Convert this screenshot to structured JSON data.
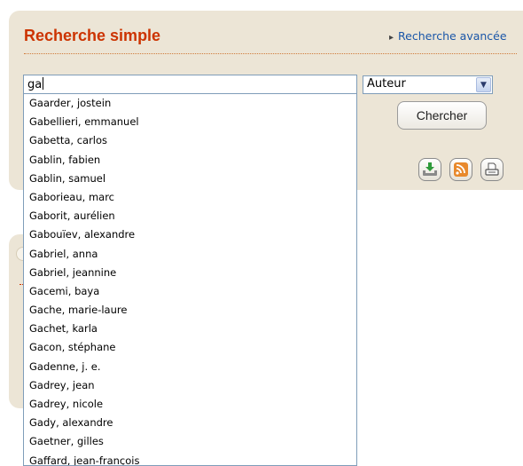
{
  "header": {
    "title": "Recherche simple",
    "advanced_link": "Recherche avancée"
  },
  "search": {
    "value": "ga",
    "field_select": "Auteur",
    "submit_label": "Chercher"
  },
  "actions": [
    "download-icon",
    "rss-icon",
    "print-icon"
  ],
  "suggestions": [
    "Gaarder, jostein",
    "Gabellieri, emmanuel",
    "Gabetta, carlos",
    "Gablin, fabien",
    "Gablin, samuel",
    "Gaborieau, marc",
    "Gaborit, aurélien",
    "Gabouïev, alexandre",
    "Gabriel, anna",
    "Gabriel, jeannine",
    "Gacemi, baya",
    "Gache, marie-laure",
    "Gachet, karla",
    "Gacon, stéphane",
    "Gadenne, j. e.",
    "Gadrey, jean",
    "Gadrey, nicole",
    "Gady, alexandre",
    "Gaetner, gilles",
    "Gaffard, jean-françois"
  ],
  "colors": {
    "panel_bg": "#ece5d6",
    "title": "#cc3300",
    "link": "#1a56a8",
    "input_border": "#7f9db9"
  }
}
